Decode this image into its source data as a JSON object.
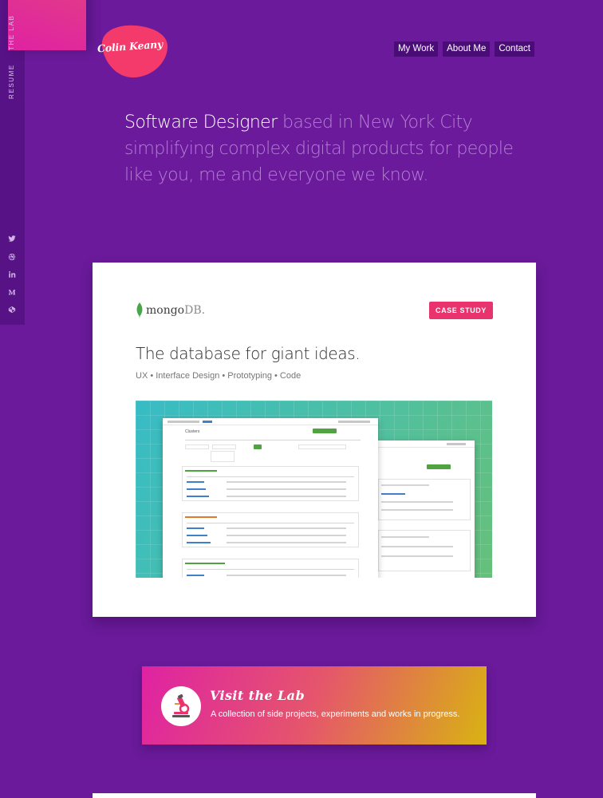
{
  "rail": {
    "links": [
      "THE LAB",
      "RESUME"
    ],
    "social_icons": [
      "twitter-icon",
      "dribbble-icon",
      "linkedin-icon",
      "medium-icon",
      "codepen-icon"
    ]
  },
  "logo": {
    "text": "Colin Keany"
  },
  "nav": {
    "items": [
      "My Work",
      "About Me",
      "Contact"
    ]
  },
  "hero": {
    "strong": "Software Designer",
    "line1_rest": " based in New York City",
    "line2": "simplifying complex digital products for people",
    "line3": "like you, me and everyone we know."
  },
  "case_study": {
    "brand_main": "mongo",
    "brand_suffix": "DB.",
    "badge": "CASE STUDY",
    "title": "The database for giant ideas.",
    "subtitle": "UX • Interface Design • Prototyping • Code",
    "preview_heading": "Clusters"
  },
  "lab_banner": {
    "title": "Visit the Lab",
    "subtitle": "A collection of side projects, experiments and works in progress.",
    "icon": "microscope-icon"
  },
  "colors": {
    "background": "#6a1a9a",
    "rail": "#571285",
    "nav_bg": "#4a0d77",
    "accent_pink": "#e8336f",
    "logo_blob": "#f33a6a"
  }
}
